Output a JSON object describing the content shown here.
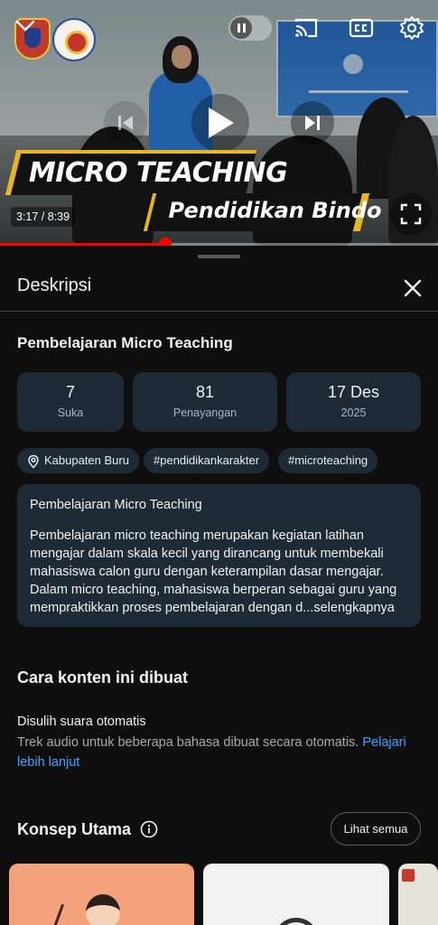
{
  "player": {
    "timecode": "3:17 / 8:39",
    "progress_fraction": 0.378,
    "overlay_title_line1": "MICRO TEACHING",
    "overlay_title_line2": "Pendidikan Bindo",
    "icons": {
      "collapse": "chevron-down-icon",
      "autoplay": "pause-toggle-icon",
      "cast": "cast-icon",
      "captions": "cc-icon",
      "settings": "gear-icon",
      "previous": "skip-previous-icon",
      "play": "play-icon",
      "next": "skip-next-icon",
      "fullscreen": "fullscreen-icon"
    },
    "accent": "#ff0000"
  },
  "sheet": {
    "title": "Deskripsi",
    "video_title": "Pembelajaran Micro Teaching",
    "stats": [
      {
        "value": "7",
        "label": "Suka"
      },
      {
        "value": "81",
        "label": "Penayangan"
      },
      {
        "value": "17 Des",
        "label": "2025"
      }
    ],
    "chips": {
      "location": "Kabupaten Buru",
      "tag1": "#pendidikankarakter",
      "tag2": "#microteaching"
    },
    "description": {
      "heading": "Pembelajaran Micro Teaching",
      "body": "Pembelajaran micro teaching merupakan kegiatan latihan mengajar dalam skala kecil yang dirancang untuk membekali mahasiswa calon guru dengan keterampilan dasar mengajar. Dalam micro teaching, mahasiswa berperan sebagai guru yang mempraktikkan proses pembelajaran dengan d...",
      "more": "selengkapnya"
    },
    "how_made": {
      "title": "Cara konten ini dibuat",
      "item_title": "Disulih suara otomatis",
      "item_body": "Trek audio untuk beberapa bahasa dibuat secara otomatis.",
      "link": "Pelajari lebih lanjut"
    },
    "concepts": {
      "title": "Konsep Utama",
      "see_all": "Lihat semua"
    },
    "link_color": "#3ea6ff"
  }
}
